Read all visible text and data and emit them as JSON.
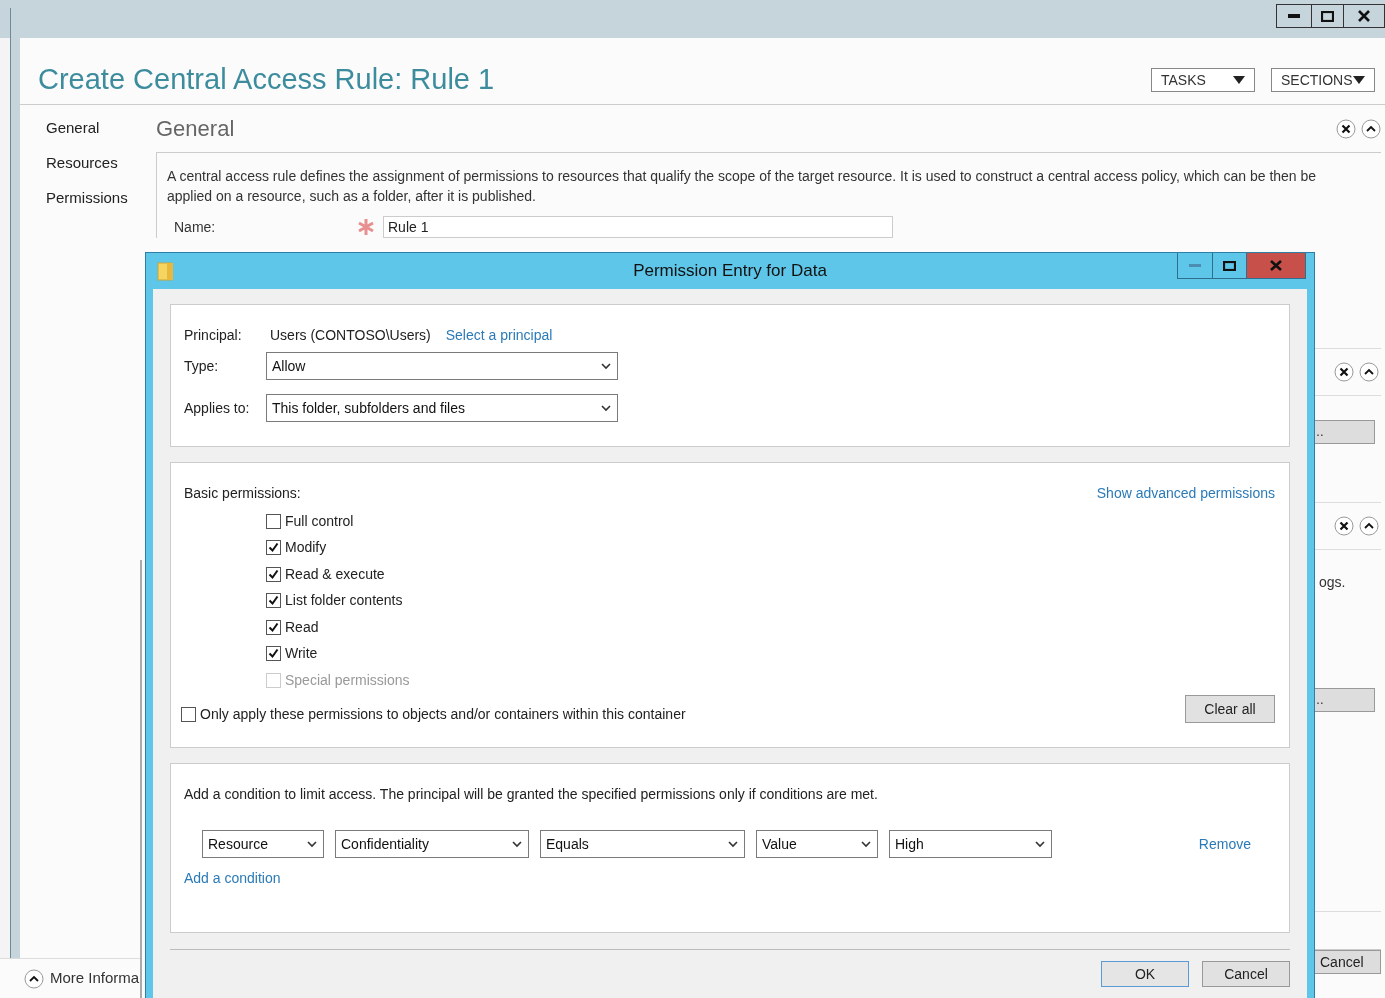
{
  "window": {
    "title": "Create Central Access Rule: Rule 1",
    "menus": [
      "TASKS",
      "SECTIONS"
    ]
  },
  "nav": [
    {
      "label": "General"
    },
    {
      "label": "Resources"
    },
    {
      "label": "Permissions"
    }
  ],
  "general": {
    "heading": "General",
    "description": "A central access rule defines the assignment of permissions to resources that qualify the scope of the target resource. It is used to construct a central access policy, which can be then be applied on a resource, such as a folder, after it is published.",
    "name_label": "Name:",
    "name_value": "Rule 1"
  },
  "background": {
    "partial_buttons": [
      "…",
      "…"
    ],
    "partial_text": "ogs.",
    "cancel": "Cancel",
    "more_info": "More Informa"
  },
  "dialog": {
    "title": "Permission Entry for Data",
    "principal_label": "Principal:",
    "principal_value": "Users (CONTOSO\\Users)",
    "select_link": "Select a principal",
    "type_label": "Type:",
    "type_value": "Allow",
    "applies_label": "Applies to:",
    "applies_value": "This folder, subfolders and files",
    "basic_label": "Basic permissions:",
    "advanced_link": "Show advanced permissions",
    "permissions": [
      {
        "label": "Full control",
        "checked": false,
        "disabled": false
      },
      {
        "label": "Modify",
        "checked": true,
        "disabled": false
      },
      {
        "label": "Read & execute",
        "checked": true,
        "disabled": false
      },
      {
        "label": "List folder contents",
        "checked": true,
        "disabled": false
      },
      {
        "label": "Read",
        "checked": true,
        "disabled": false
      },
      {
        "label": "Write",
        "checked": true,
        "disabled": false
      },
      {
        "label": "Special permissions",
        "checked": false,
        "disabled": true
      }
    ],
    "only_apply": {
      "label": "Only apply these permissions to objects and/or containers within this container",
      "checked": false
    },
    "clear_all": "Clear all",
    "condition_text": "Add a condition to limit access. The principal will be granted the specified permissions only if conditions are met.",
    "condition": [
      "Resource",
      "Confidentiality",
      "Equals",
      "Value",
      "High"
    ],
    "remove": "Remove",
    "add_condition": "Add a condition",
    "buttons": [
      "OK",
      "Cancel"
    ]
  }
}
